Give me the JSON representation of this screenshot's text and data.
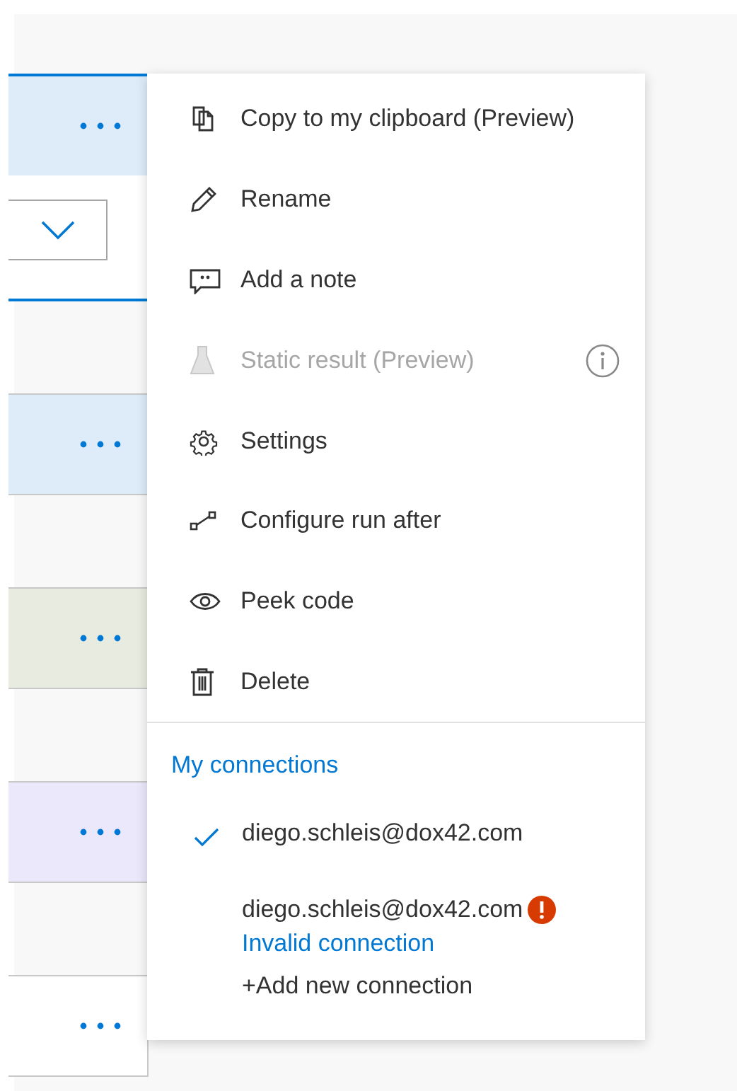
{
  "cards": [
    {
      "color": "#deecf9",
      "selected": true,
      "expanded": true
    },
    {
      "color": "#deecf9",
      "selected": false,
      "expanded": false
    },
    {
      "color": "#e8ebdf",
      "selected": false,
      "expanded": false
    },
    {
      "color": "#ebe8fb",
      "selected": false,
      "expanded": false
    },
    {
      "color": "#ffffff",
      "selected": false,
      "expanded": false
    }
  ],
  "menu": {
    "items": [
      {
        "kind": "copy",
        "label": "Copy to my clipboard (Preview)",
        "disabled": false,
        "info": false
      },
      {
        "kind": "rename",
        "label": "Rename",
        "disabled": false,
        "info": false
      },
      {
        "kind": "note",
        "label": "Add a note",
        "disabled": false,
        "info": false
      },
      {
        "kind": "flask",
        "label": "Static result (Preview)",
        "disabled": true,
        "info": true
      },
      {
        "kind": "gear",
        "label": "Settings",
        "disabled": false,
        "info": false
      },
      {
        "kind": "link",
        "label": "Configure run after",
        "disabled": false,
        "info": false
      },
      {
        "kind": "eye",
        "label": "Peek code",
        "disabled": false,
        "info": false
      },
      {
        "kind": "trash",
        "label": "Delete",
        "disabled": false,
        "info": false
      }
    ],
    "connections_title": "My connections",
    "connections": [
      {
        "email": "diego.schleis@dox42.com",
        "selected": true,
        "error": false
      },
      {
        "email": "diego.schleis@dox42.com",
        "selected": false,
        "error": true,
        "status": "Invalid connection"
      }
    ],
    "add_connection": "+Add new connection"
  }
}
